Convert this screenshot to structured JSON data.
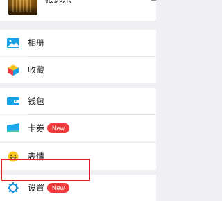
{
  "profile": {
    "name": "张远乐"
  },
  "menu": {
    "album": "相册",
    "favorites": "收藏",
    "wallet": "钱包",
    "cards": "卡券",
    "stickers": "表情",
    "settings": "设置"
  },
  "badges": {
    "cards": "New",
    "settings": "New"
  },
  "icons": {
    "album": "image-icon",
    "favorites": "cube-icon",
    "wallet": "wallet-icon",
    "cards": "card-icon",
    "stickers": "emoji-icon",
    "settings": "gear-icon"
  },
  "colors": {
    "badge": "#ef3b3b",
    "highlight": "#e0202a",
    "album_icon": "#1aa0e6",
    "wallet_icon": "#1aa0e6",
    "cards_icon": "#19a9e8",
    "stickers_icon": "#f7c51e",
    "settings_icon": "#1b8fd6"
  }
}
